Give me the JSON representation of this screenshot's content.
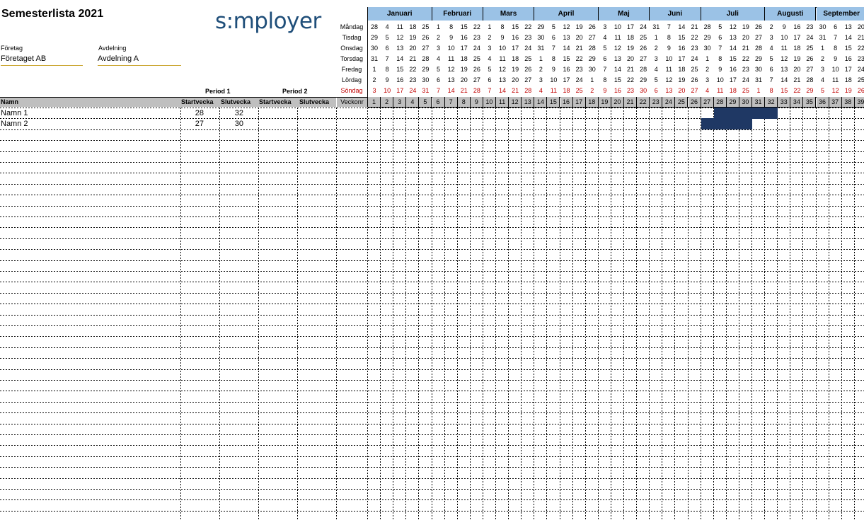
{
  "title": "Semesterlista 2021",
  "logo": "s:mployer",
  "company": {
    "label": "Företag",
    "value": "Företaget AB"
  },
  "department": {
    "label": "Avdelning",
    "value": "Avdelning A"
  },
  "periods": [
    "Period 1",
    "Period 2"
  ],
  "columns": {
    "name": "Namn",
    "start": "Startvecka",
    "end": "Slutvecka",
    "week": "Veckonr"
  },
  "days": [
    "Måndag",
    "Tisdag",
    "Onsdag",
    "Torsdag",
    "Fredag",
    "Lördag",
    "Söndag"
  ],
  "months": [
    {
      "name": "Januari",
      "weeks": 5
    },
    {
      "name": "Februari",
      "weeks": 4
    },
    {
      "name": "Mars",
      "weeks": 4
    },
    {
      "name": "April",
      "weeks": 5
    },
    {
      "name": "Maj",
      "weeks": 4
    },
    {
      "name": "Juni",
      "weeks": 4
    },
    {
      "name": "Juli",
      "weeks": 5
    },
    {
      "name": "Augusti",
      "weeks": 4
    },
    {
      "name": "September",
      "weeks": 4
    }
  ],
  "weeks": [
    {
      "no": "1",
      "dates": [
        "28",
        "29",
        "30",
        "31",
        "1",
        "2",
        "3"
      ]
    },
    {
      "no": "2",
      "dates": [
        "4",
        "5",
        "6",
        "7",
        "8",
        "9",
        "10"
      ]
    },
    {
      "no": "3",
      "dates": [
        "11",
        "12",
        "13",
        "14",
        "15",
        "16",
        "17"
      ]
    },
    {
      "no": "4",
      "dates": [
        "18",
        "19",
        "20",
        "21",
        "22",
        "23",
        "24"
      ]
    },
    {
      "no": "5",
      "dates": [
        "25",
        "26",
        "27",
        "28",
        "29",
        "30",
        "31"
      ]
    },
    {
      "no": "6",
      "dates": [
        "1",
        "2",
        "3",
        "4",
        "5",
        "6",
        "7"
      ]
    },
    {
      "no": "7",
      "dates": [
        "8",
        "9",
        "10",
        "11",
        "12",
        "13",
        "14"
      ]
    },
    {
      "no": "8",
      "dates": [
        "15",
        "16",
        "17",
        "18",
        "19",
        "20",
        "21"
      ]
    },
    {
      "no": "9",
      "dates": [
        "22",
        "23",
        "24",
        "25",
        "26",
        "27",
        "28"
      ]
    },
    {
      "no": "10",
      "dates": [
        "1",
        "2",
        "3",
        "4",
        "5",
        "6",
        "7"
      ]
    },
    {
      "no": "11",
      "dates": [
        "8",
        "9",
        "10",
        "11",
        "12",
        "13",
        "14"
      ]
    },
    {
      "no": "12",
      "dates": [
        "15",
        "16",
        "17",
        "18",
        "19",
        "20",
        "21"
      ]
    },
    {
      "no": "13",
      "dates": [
        "22",
        "23",
        "24",
        "25",
        "26",
        "27",
        "28"
      ]
    },
    {
      "no": "14",
      "dates": [
        "29",
        "30",
        "31",
        "1",
        "2",
        "3",
        "4"
      ]
    },
    {
      "no": "15",
      "dates": [
        "5",
        "6",
        "7",
        "8",
        "9",
        "10",
        "11"
      ]
    },
    {
      "no": "16",
      "dates": [
        "12",
        "13",
        "14",
        "15",
        "16",
        "17",
        "18"
      ]
    },
    {
      "no": "17",
      "dates": [
        "19",
        "20",
        "21",
        "22",
        "23",
        "24",
        "25"
      ]
    },
    {
      "no": "18",
      "dates": [
        "26",
        "27",
        "28",
        "29",
        "30",
        "1",
        "2"
      ]
    },
    {
      "no": "19",
      "dates": [
        "3",
        "4",
        "5",
        "6",
        "7",
        "8",
        "9"
      ]
    },
    {
      "no": "20",
      "dates": [
        "10",
        "11",
        "12",
        "13",
        "14",
        "15",
        "16"
      ]
    },
    {
      "no": "21",
      "dates": [
        "17",
        "18",
        "19",
        "20",
        "21",
        "22",
        "23"
      ]
    },
    {
      "no": "22",
      "dates": [
        "24",
        "25",
        "26",
        "27",
        "28",
        "29",
        "30"
      ]
    },
    {
      "no": "23",
      "dates": [
        "31",
        "1",
        "2",
        "3",
        "4",
        "5",
        "6"
      ]
    },
    {
      "no": "24",
      "dates": [
        "7",
        "8",
        "9",
        "10",
        "11",
        "12",
        "13"
      ]
    },
    {
      "no": "25",
      "dates": [
        "14",
        "15",
        "16",
        "17",
        "18",
        "19",
        "20"
      ]
    },
    {
      "no": "26",
      "dates": [
        "21",
        "22",
        "23",
        "24",
        "25",
        "26",
        "27"
      ]
    },
    {
      "no": "27",
      "dates": [
        "28",
        "29",
        "30",
        "1",
        "2",
        "3",
        "4"
      ]
    },
    {
      "no": "28",
      "dates": [
        "5",
        "6",
        "7",
        "8",
        "9",
        "10",
        "11"
      ]
    },
    {
      "no": "29",
      "dates": [
        "12",
        "13",
        "14",
        "15",
        "16",
        "17",
        "18"
      ]
    },
    {
      "no": "30",
      "dates": [
        "19",
        "20",
        "21",
        "22",
        "23",
        "24",
        "25"
      ]
    },
    {
      "no": "31",
      "dates": [
        "26",
        "27",
        "28",
        "29",
        "30",
        "31",
        "1"
      ]
    },
    {
      "no": "32",
      "dates": [
        "2",
        "3",
        "4",
        "5",
        "6",
        "7",
        "8"
      ]
    },
    {
      "no": "33",
      "dates": [
        "9",
        "10",
        "11",
        "12",
        "13",
        "14",
        "15"
      ]
    },
    {
      "no": "34",
      "dates": [
        "16",
        "17",
        "18",
        "19",
        "20",
        "21",
        "22"
      ]
    },
    {
      "no": "35",
      "dates": [
        "23",
        "24",
        "25",
        "26",
        "27",
        "28",
        "29"
      ]
    },
    {
      "no": "36",
      "dates": [
        "30",
        "31",
        "1",
        "2",
        "3",
        "4",
        "5"
      ]
    },
    {
      "no": "37",
      "dates": [
        "6",
        "7",
        "8",
        "9",
        "10",
        "11",
        "12"
      ]
    },
    {
      "no": "38",
      "dates": [
        "13",
        "14",
        "15",
        "16",
        "17",
        "18",
        "19"
      ]
    },
    {
      "no": "39",
      "dates": [
        "20",
        "21",
        "22",
        "23",
        "24",
        "25",
        "26"
      ]
    }
  ],
  "people": [
    {
      "name": "Namn 1",
      "p1_start": "28",
      "p1_end": "32"
    },
    {
      "name": "Namn 2",
      "p1_start": "27",
      "p1_end": "30"
    }
  ],
  "colors": {
    "month_header": "#9bc2e6",
    "week_row": "#bfbfbf",
    "vacation": "#1f3864",
    "holiday": "#c00000",
    "logo": "#1f4e79"
  }
}
